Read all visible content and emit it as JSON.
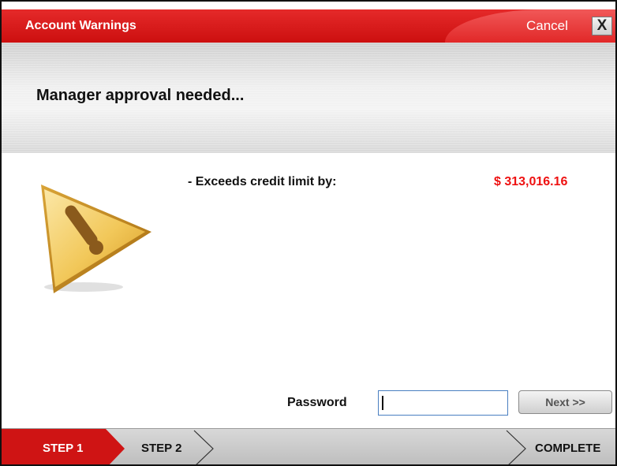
{
  "window": {
    "title": "Account Warnings",
    "cancel_label": "Cancel",
    "close_glyph": "X"
  },
  "header": {
    "title": "Manager approval needed..."
  },
  "warnings": [
    {
      "label": "- Exceeds credit limit by:",
      "value": "$ 313,016.16"
    }
  ],
  "form": {
    "password_label": "Password",
    "password_value": "",
    "next_label": "Next >>"
  },
  "steps": [
    {
      "label": "STEP 1",
      "active": true
    },
    {
      "label": "STEP 2",
      "active": false
    },
    {
      "label": "COMPLETE",
      "active": false
    }
  ],
  "icons": {
    "warning": "warning-triangle-icon",
    "close": "close-icon"
  },
  "colors": {
    "brand_red": "#d81b1b",
    "amount_red": "#ee1111",
    "input_border": "#4a7fc1"
  }
}
